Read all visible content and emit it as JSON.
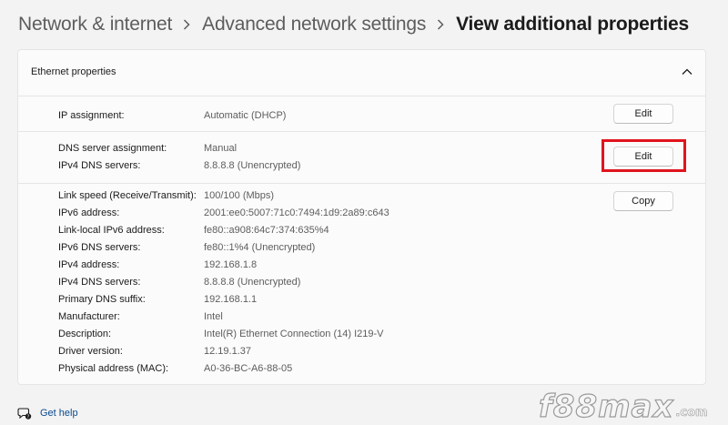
{
  "breadcrumb": {
    "items": [
      "Network & internet",
      "Advanced network settings"
    ],
    "current": "View additional properties"
  },
  "panel": {
    "title": "Ethernet properties",
    "sections": [
      {
        "rows": [
          {
            "label": "IP assignment:",
            "value": "Automatic (DHCP)"
          }
        ],
        "button": "Edit"
      },
      {
        "rows": [
          {
            "label": "DNS server assignment:",
            "value": "Manual"
          },
          {
            "label": "IPv4 DNS servers:",
            "value": "8.8.8.8 (Unencrypted)"
          }
        ],
        "button": "Edit"
      },
      {
        "rows": [
          {
            "label": "Link speed (Receive/Transmit):",
            "value": "100/100 (Mbps)"
          },
          {
            "label": "IPv6 address:",
            "value": "2001:ee0:5007:71c0:7494:1d9:2a89:c643"
          },
          {
            "label": "Link-local IPv6 address:",
            "value": "fe80::a908:64c7:374:635%4"
          },
          {
            "label": "IPv6 DNS servers:",
            "value": "fe80::1%4 (Unencrypted)"
          },
          {
            "label": "IPv4 address:",
            "value": "192.168.1.8"
          },
          {
            "label": "IPv4 DNS servers:",
            "value": "8.8.8.8 (Unencrypted)"
          },
          {
            "label": "Primary DNS suffix:",
            "value": "192.168.1.1"
          },
          {
            "label": "Manufacturer:",
            "value": "Intel"
          },
          {
            "label": "Description:",
            "value": "Intel(R) Ethernet Connection (14) I219-V"
          },
          {
            "label": "Driver version:",
            "value": "12.19.1.37"
          },
          {
            "label": "Physical address (MAC):",
            "value": "A0-36-BC-A6-88-05"
          }
        ],
        "button": "Copy"
      }
    ]
  },
  "help": {
    "label": "Get help"
  },
  "watermark": {
    "main": "f88max",
    "domain": ".com"
  },
  "colors": {
    "highlight": "#e0141e",
    "link": "#0b4a8e"
  }
}
